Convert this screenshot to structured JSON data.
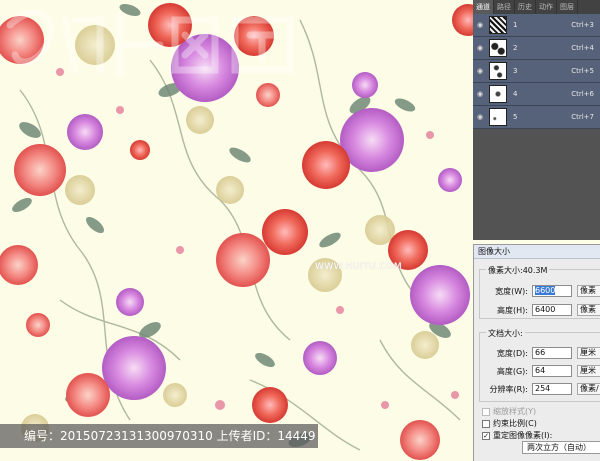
{
  "watermark": {
    "url": "WWW.HUITU.COM"
  },
  "infobar": {
    "label_id": "编号",
    "id": "20150723131300970310",
    "label_uploader": "上传者ID",
    "uploader_id": "14449"
  },
  "channels_panel": {
    "tabs": [
      "通道",
      "路径",
      "历史",
      "动作",
      "图层"
    ],
    "rows": [
      {
        "name": "1",
        "shortcut": "Ctrl+3"
      },
      {
        "name": "2",
        "shortcut": "Ctrl+4"
      },
      {
        "name": "3",
        "shortcut": "Ctrl+5"
      },
      {
        "name": "4",
        "shortcut": "Ctrl+6"
      },
      {
        "name": "5",
        "shortcut": "Ctrl+7"
      }
    ]
  },
  "image_size_dialog": {
    "title": "图像大小",
    "pixel_dimensions": "像素大小:40.3M",
    "width_label": "宽度(W):",
    "width_value": "6600",
    "width_unit": "像素",
    "height_label": "高度(H):",
    "height_value": "6400",
    "height_unit": "像素",
    "document_size": "文档大小:",
    "doc_width_label": "宽度(D):",
    "doc_width_value": "66",
    "doc_width_unit": "厘米",
    "doc_height_label": "高度(G):",
    "doc_height_value": "64",
    "doc_height_unit": "厘米",
    "resolution_label": "分辨率(R):",
    "resolution_value": "254",
    "resolution_unit": "像素/",
    "scale_styles": "缩放样式(Y)",
    "constrain_proportions": "约束比例(C)",
    "resample": "重定图像像素(I):",
    "resample_method": "两次立方（自动）"
  },
  "colors": {
    "canvas_bg": "#fdfce6",
    "panel_bg": "#535353",
    "channel_row": "#56627a",
    "selection": "#3a7bd5"
  }
}
